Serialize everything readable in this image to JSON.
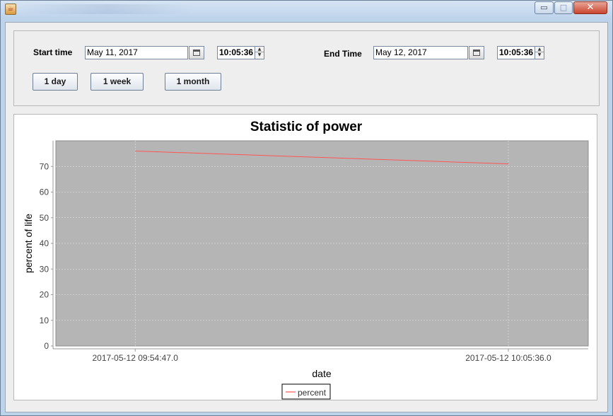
{
  "window": {
    "app_icon_glyph": "☕",
    "minimize_glyph": "▭",
    "maximize_glyph": "□",
    "close_glyph": "✕"
  },
  "controls": {
    "start_label": "Start time",
    "start_date": "May 11, 2017",
    "start_time": "10:05:36",
    "end_label": "End Time",
    "end_date": "May 12, 2017",
    "end_time": "10:05:36",
    "spin_up": "▲",
    "spin_down": "▼",
    "buttons": {
      "day": "1 day",
      "week": "1 week",
      "month": "1 month"
    }
  },
  "colors": {
    "plot_background": "#b5b5b5",
    "series_line": "#ff5555",
    "gridline": "#e6e6e6"
  },
  "chart_data": {
    "type": "line",
    "title": "Statistic of power",
    "xlabel": "date",
    "ylabel": "percent of life",
    "ylim": [
      0,
      80
    ],
    "yticks": [
      0,
      10,
      20,
      30,
      40,
      50,
      60,
      70
    ],
    "xlim": [
      "2017-05-12 09:52:29",
      "2017-05-12 10:07:55"
    ],
    "xtick_labels": [
      "2017-05-12 09:54:47.0",
      "2017-05-12 10:05:36.0"
    ],
    "grid": true,
    "legend_position": "bottom",
    "series": [
      {
        "name": "percent",
        "x": [
          "2017-05-12 09:54:47",
          "2017-05-12 10:05:36"
        ],
        "y": [
          76,
          71
        ]
      }
    ]
  }
}
